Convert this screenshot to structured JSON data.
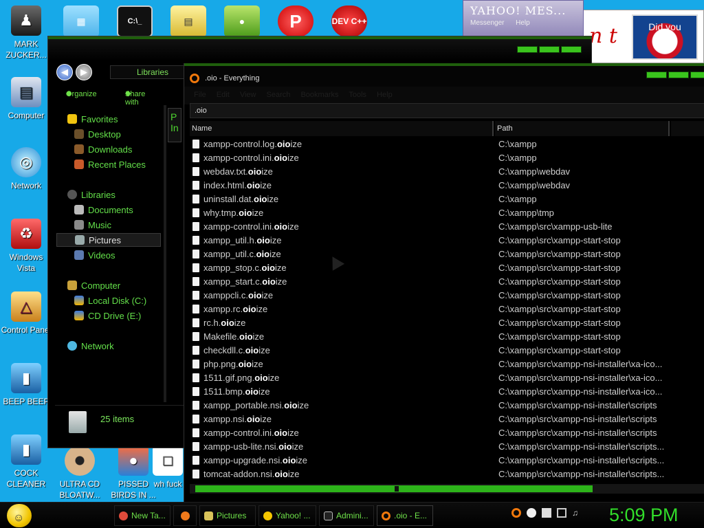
{
  "desktop": {
    "icons": [
      {
        "label": "MARK ZUCKER...",
        "icon": "person-icon"
      },
      {
        "label": "Computer",
        "icon": "computer-icon"
      },
      {
        "label": "Network",
        "icon": "globe-icon"
      },
      {
        "label": "Windows Vista",
        "icon": "recycle-bin-icon"
      },
      {
        "label": "Control Panel",
        "icon": "control-panel-icon"
      },
      {
        "label": "BEEP BEEP",
        "icon": "drive-icon"
      },
      {
        "label": "COCK CLEANER",
        "icon": "drive-icon"
      },
      {
        "label": "ULTRA CD BLOATW...",
        "icon": "cd-icon"
      },
      {
        "label": "PISSED BIRDS IN ...",
        "icon": "birds-icon"
      },
      {
        "label": "wh fuck",
        "icon": "file-icon"
      }
    ],
    "top_icons": [
      "dev_label_icon",
      "cmd-icon",
      "folder-icon",
      "birds-icon",
      "p-app-icon",
      "dev-cpp-icon"
    ],
    "dev_cpp_label": "DEV C++",
    "p_app_label": "P"
  },
  "yahoo_window": {
    "title": "YAHOO! MES...",
    "menu": [
      "Messenger",
      "Help"
    ]
  },
  "obama_ad": {
    "text": "n t",
    "badge": "Did you"
  },
  "explorer": {
    "address": "Libraries",
    "toolbar": {
      "organize": "Organize",
      "share_with": "Share with"
    },
    "sidebar": [
      {
        "label": "Favorites",
        "icon": "star-icon"
      },
      {
        "label": "Desktop",
        "icon": "desktop-icon"
      },
      {
        "label": "Downloads",
        "icon": "download-icon"
      },
      {
        "label": "Recent Places",
        "icon": "recent-icon"
      },
      {
        "label": "Libraries",
        "icon": "library-icon"
      },
      {
        "label": "Documents",
        "icon": "document-icon"
      },
      {
        "label": "Music",
        "icon": "music-icon"
      },
      {
        "label": "Pictures",
        "icon": "pictures-icon"
      },
      {
        "label": "Videos",
        "icon": "video-icon"
      },
      {
        "label": "Computer",
        "icon": "computer-icon"
      },
      {
        "label": "Local Disk (C:)",
        "icon": "disk-icon"
      },
      {
        "label": "CD Drive (E:)",
        "icon": "cd-icon"
      },
      {
        "label": "Network",
        "icon": "network-icon"
      }
    ],
    "selected_item": "Pictures",
    "item_count": "25 items",
    "ghost_header": "P In"
  },
  "everything": {
    "title": ".oio - Everything",
    "menu": [
      "File",
      "Edit",
      "View",
      "Search",
      "Bookmarks",
      "Tools",
      "Help"
    ],
    "search_value": ".oio",
    "columns": {
      "name": "Name",
      "path": "Path"
    },
    "rows": [
      {
        "pre": "xampp-control.log.",
        "hl": "oio",
        "post": "ize",
        "path": "C:\\xampp"
      },
      {
        "pre": "xampp-control.ini.",
        "hl": "oio",
        "post": "ize",
        "path": "C:\\xampp"
      },
      {
        "pre": "webdav.txt.",
        "hl": "oio",
        "post": "ize",
        "path": "C:\\xampp\\webdav"
      },
      {
        "pre": "index.html.",
        "hl": "oio",
        "post": "ize",
        "path": "C:\\xampp\\webdav"
      },
      {
        "pre": "uninstall.dat.",
        "hl": "oio",
        "post": "ize",
        "path": "C:\\xampp"
      },
      {
        "pre": "why.tmp.",
        "hl": "oio",
        "post": "ize",
        "path": "C:\\xampp\\tmp"
      },
      {
        "pre": "xampp-control.ini.",
        "hl": "oio",
        "post": "ize",
        "path": "C:\\xampp\\src\\xampp-usb-lite"
      },
      {
        "pre": "xampp_util.h.",
        "hl": "oio",
        "post": "ize",
        "path": "C:\\xampp\\src\\xampp-start-stop"
      },
      {
        "pre": "xampp_util.c.",
        "hl": "oio",
        "post": "ize",
        "path": "C:\\xampp\\src\\xampp-start-stop"
      },
      {
        "pre": "xampp_stop.c.",
        "hl": "oio",
        "post": "ize",
        "path": "C:\\xampp\\src\\xampp-start-stop"
      },
      {
        "pre": "xampp_start.c.",
        "hl": "oio",
        "post": "ize",
        "path": "C:\\xampp\\src\\xampp-start-stop"
      },
      {
        "pre": "xamppcli.c.",
        "hl": "oio",
        "post": "ize",
        "path": "C:\\xampp\\src\\xampp-start-stop"
      },
      {
        "pre": "xampp.rc.",
        "hl": "oio",
        "post": "ize",
        "path": "C:\\xampp\\src\\xampp-start-stop"
      },
      {
        "pre": "rc.h.",
        "hl": "oio",
        "post": "ize",
        "path": "C:\\xampp\\src\\xampp-start-stop"
      },
      {
        "pre": "Makefile.",
        "hl": "oio",
        "post": "ize",
        "path": "C:\\xampp\\src\\xampp-start-stop"
      },
      {
        "pre": "checkdll.c.",
        "hl": "oio",
        "post": "ize",
        "path": "C:\\xampp\\src\\xampp-start-stop"
      },
      {
        "pre": "php.png.",
        "hl": "oio",
        "post": "ize",
        "path": "C:\\xampp\\src\\xampp-nsi-installer\\xa-ico..."
      },
      {
        "pre": "1511.gif.png.",
        "hl": "oio",
        "post": "ize",
        "path": "C:\\xampp\\src\\xampp-nsi-installer\\xa-ico..."
      },
      {
        "pre": "1511.bmp.",
        "hl": "oio",
        "post": "ize",
        "path": "C:\\xampp\\src\\xampp-nsi-installer\\xa-ico..."
      },
      {
        "pre": "xampp_portable.nsi.",
        "hl": "oio",
        "post": "ize",
        "path": "C:\\xampp\\src\\xampp-nsi-installer\\scripts"
      },
      {
        "pre": "xampp.nsi.",
        "hl": "oio",
        "post": "ize",
        "path": "C:\\xampp\\src\\xampp-nsi-installer\\scripts"
      },
      {
        "pre": "xampp-control.ini.",
        "hl": "oio",
        "post": "ize",
        "path": "C:\\xampp\\src\\xampp-nsi-installer\\scripts"
      },
      {
        "pre": "xampp-usb-lite.nsi.",
        "hl": "oio",
        "post": "ize",
        "path": "C:\\xampp\\src\\xampp-nsi-installer\\scripts..."
      },
      {
        "pre": "xampp-upgrade.nsi.",
        "hl": "oio",
        "post": "ize",
        "path": "C:\\xampp\\src\\xampp-nsi-installer\\scripts..."
      },
      {
        "pre": "tomcat-addon.nsi.",
        "hl": "oio",
        "post": "ize",
        "path": "C:\\xampp\\src\\xampp-nsi-installer\\scripts..."
      }
    ]
  },
  "taskbar": {
    "items": [
      {
        "label": "New Ta...",
        "icon": "chrome-icon",
        "color": "#e04b3b"
      },
      {
        "label": "",
        "icon": "firefox-icon",
        "color": "#f07a1b"
      },
      {
        "label": "Pictures",
        "icon": "folder-icon",
        "color": "#d9c35a"
      },
      {
        "label": "Yahoo! ...",
        "icon": "yahoo-smiley-icon",
        "color": "#f5c600"
      },
      {
        "label": "Admini...",
        "icon": "cmd-icon",
        "color": "#bbbbbb"
      },
      {
        "label": ".oio - E...",
        "icon": "everything-icon",
        "color": "#f0780c"
      }
    ],
    "tray": [
      "search-tray-icon",
      "minus-tray-icon",
      "flag-tray-icon",
      "network-tray-icon",
      "volume-tray-icon"
    ],
    "clock": "5:09 PM"
  },
  "colors": {
    "accent": "#3ac41d",
    "desktop_bg": "#17a9e8",
    "sidebar_text": "#64e04a"
  }
}
